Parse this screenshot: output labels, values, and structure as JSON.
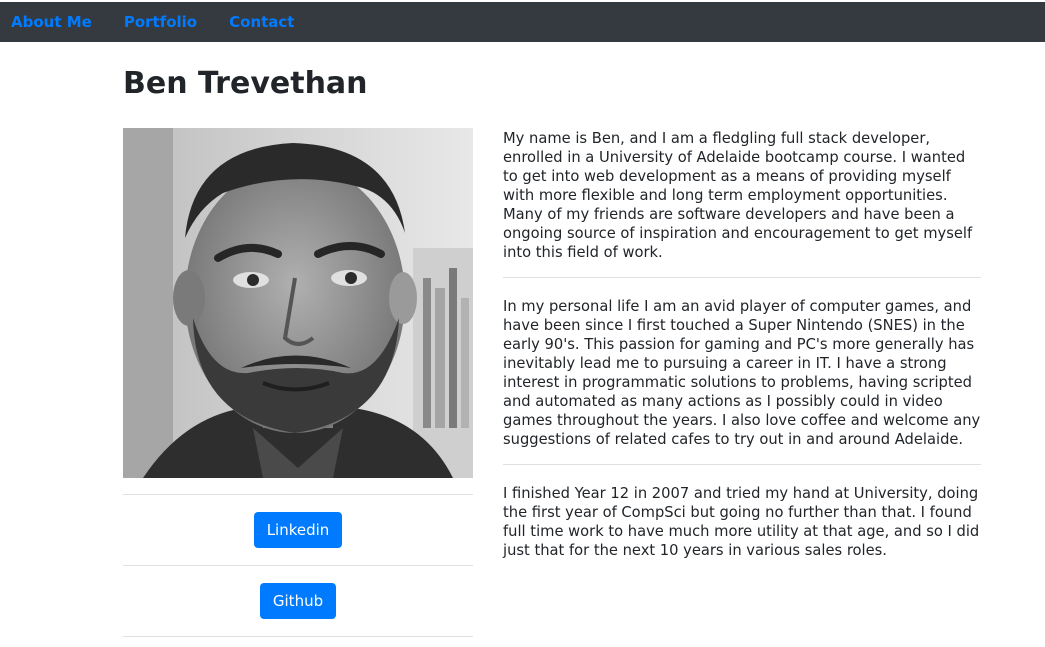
{
  "nav": {
    "items": [
      {
        "label": "About Me"
      },
      {
        "label": "Portfolio"
      },
      {
        "label": "Contact"
      }
    ]
  },
  "colors": {
    "navbar_bg": "#343a40",
    "link": "#007bff",
    "button_bg": "#007bff",
    "text": "#212529"
  },
  "page": {
    "title": "Ben Trevethan"
  },
  "profile": {
    "photo": "portrait-photo-grayscale"
  },
  "links": [
    {
      "label": "Linkedin"
    },
    {
      "label": "Github"
    }
  ],
  "bio": {
    "paragraphs": [
      "My name is Ben, and I am a fledgling full stack developer, enrolled in a University of Adelaide bootcamp course. I wanted to get into web development as a means of providing myself with more flexible and long term employment opportunities. Many of my friends are software developers and have been a ongoing source of inspiration and encouragement to get myself into this field of work.",
      "In my personal life I am an avid player of computer games, and have been since I first touched a Super Nintendo (SNES) in the early 90's. This passion for gaming and PC's more generally has inevitably lead me to pursuing a career in IT. I have a strong interest in programmatic solutions to problems, having scripted and automated as many actions as I possibly could in video games throughout the years. I also love coffee and welcome any suggestions of related cafes to try out in and around Adelaide.",
      "I finished Year 12 in 2007 and tried my hand at University, doing the first year of CompSci but going no further than that. I found full time work to have much more utility at that age, and so I did just that for the next 10 years in various sales roles."
    ]
  }
}
